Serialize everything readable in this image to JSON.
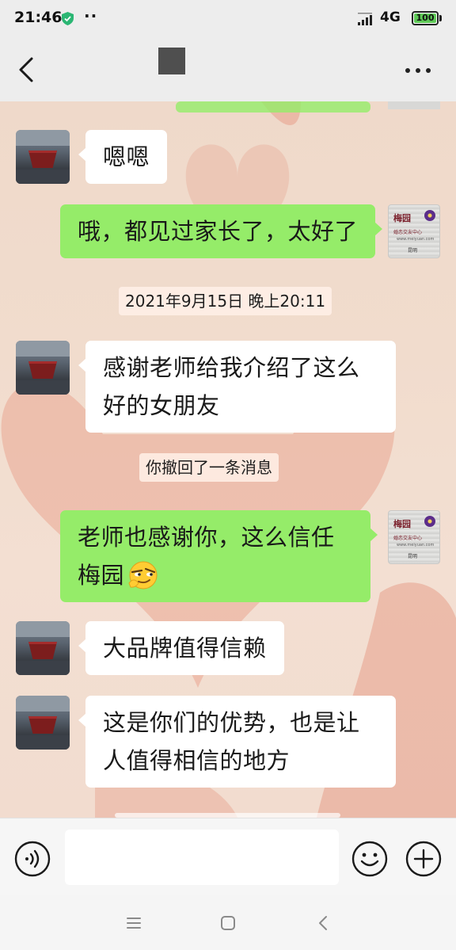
{
  "status_bar": {
    "time": "21:46",
    "extra": "··",
    "network": "4G",
    "battery": "100"
  },
  "nav": {
    "title": "",
    "colors": {
      "background": "#ededed"
    }
  },
  "messages": [
    {
      "id": "m1",
      "side": "left",
      "text": "嗯嗯"
    },
    {
      "id": "m2",
      "side": "right",
      "text": "哦，都见过家长了，太好了"
    },
    {
      "id": "t1",
      "type": "timestamp",
      "text": "2021年9月15日 晚上20:11"
    },
    {
      "id": "m3",
      "side": "left",
      "lines": [
        "感谢老师给我介绍了这么",
        "好的女朋友"
      ]
    },
    {
      "id": "s1",
      "type": "system",
      "text": "你撤回了一条消息"
    },
    {
      "id": "m4",
      "side": "right",
      "lines": [
        "老师也感谢你，这么信任",
        "梅园"
      ],
      "emoji": "smirk-face-emoji"
    },
    {
      "id": "m5",
      "side": "left",
      "text": "大品牌值得信赖"
    },
    {
      "id": "m6",
      "side": "left",
      "lines": [
        "这是你们的优势，也是让",
        "人值得相信的地方"
      ]
    }
  ],
  "logo_avatar": {
    "brand": "梅园",
    "subtitle": "婚恋交友中心",
    "website": "www.meiyuan.com",
    "tag": "昆明"
  },
  "input": {
    "value": "",
    "placeholder": ""
  },
  "colors": {
    "sent_bubble": "#95ec69",
    "received_bubble": "#ffffff",
    "chat_background": "#f1dccd"
  },
  "icons": {
    "voice": "voice-icon",
    "emoji": "smiley-icon",
    "plus": "plus-icon"
  }
}
